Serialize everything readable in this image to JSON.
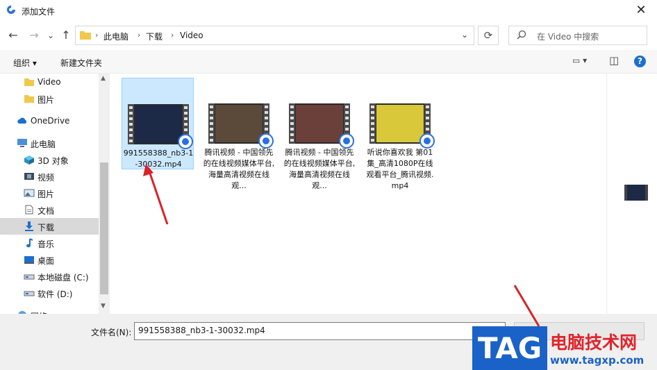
{
  "window": {
    "title": "添加文件",
    "close_icon": "✕"
  },
  "nav": {
    "back_icon": "←",
    "forward_icon": "→",
    "recent_icon": "⌄",
    "up_icon": "↑",
    "breadcrumbs": [
      "此电脑",
      "下载",
      "Video"
    ],
    "separator": "›",
    "dropdown_icon": "⌄",
    "refresh_icon": "⟳",
    "search_placeholder": "在 Video 中搜索"
  },
  "toolbar": {
    "organize": "组织 ▾",
    "new_folder": "新建文件夹",
    "view_icon": "▭ ▾",
    "pane_icon": "◫",
    "help": "?"
  },
  "sidebar": {
    "items": [
      {
        "label": "Video",
        "icon": "folder-icon",
        "indent": 2
      },
      {
        "label": "图片",
        "icon": "folder-icon",
        "indent": 2
      },
      {
        "label": "OneDrive",
        "icon": "cloud-icon",
        "indent": 1
      },
      {
        "label": "此电脑",
        "icon": "computer-icon",
        "indent": 1
      },
      {
        "label": "3D 对象",
        "icon": "cube-icon",
        "indent": 2
      },
      {
        "label": "视频",
        "icon": "video-icon",
        "indent": 2
      },
      {
        "label": "图片",
        "icon": "pictures-icon",
        "indent": 2
      },
      {
        "label": "文档",
        "icon": "document-icon",
        "indent": 2
      },
      {
        "label": "下载",
        "icon": "download-icon",
        "indent": 2,
        "selected": true
      },
      {
        "label": "音乐",
        "icon": "music-icon",
        "indent": 2
      },
      {
        "label": "桌面",
        "icon": "desktop-icon",
        "indent": 2
      },
      {
        "label": "本地磁盘 (C:)",
        "icon": "drive-icon",
        "indent": 2
      },
      {
        "label": "软件 (D:)",
        "icon": "drive-icon",
        "indent": 2
      },
      {
        "label": "网络",
        "icon": "network-icon",
        "indent": 1
      }
    ]
  },
  "files": [
    {
      "name": "991558388_nb3-1-30032.mp4",
      "selected": true,
      "color": "#1c2a48"
    },
    {
      "name": "腾讯视频 - 中国领先的在线视频媒体平台,海量高清视频在线观...",
      "selected": false,
      "color": "#5b4a3a"
    },
    {
      "name": "腾讯视频 - 中国领先的在线视频媒体平台,海量高清视频在线观...",
      "selected": false,
      "color": "#6b3f3a"
    },
    {
      "name": "听说你喜欢我 第01集_高清1080P在线观看平台_腾讯视频.mp4",
      "selected": false,
      "color": "#d8c83a"
    }
  ],
  "bottom": {
    "filename_label": "文件名(N):",
    "filename_value": "991558388_nb3-1-30032.mp4"
  },
  "watermark": {
    "tag": "TAG",
    "name": "电脑技术网",
    "url": "www.tagxp.com"
  },
  "colors": {
    "accent": "#1b6fd1",
    "selection": "#cce8ff",
    "arrow": "#d9232a"
  }
}
